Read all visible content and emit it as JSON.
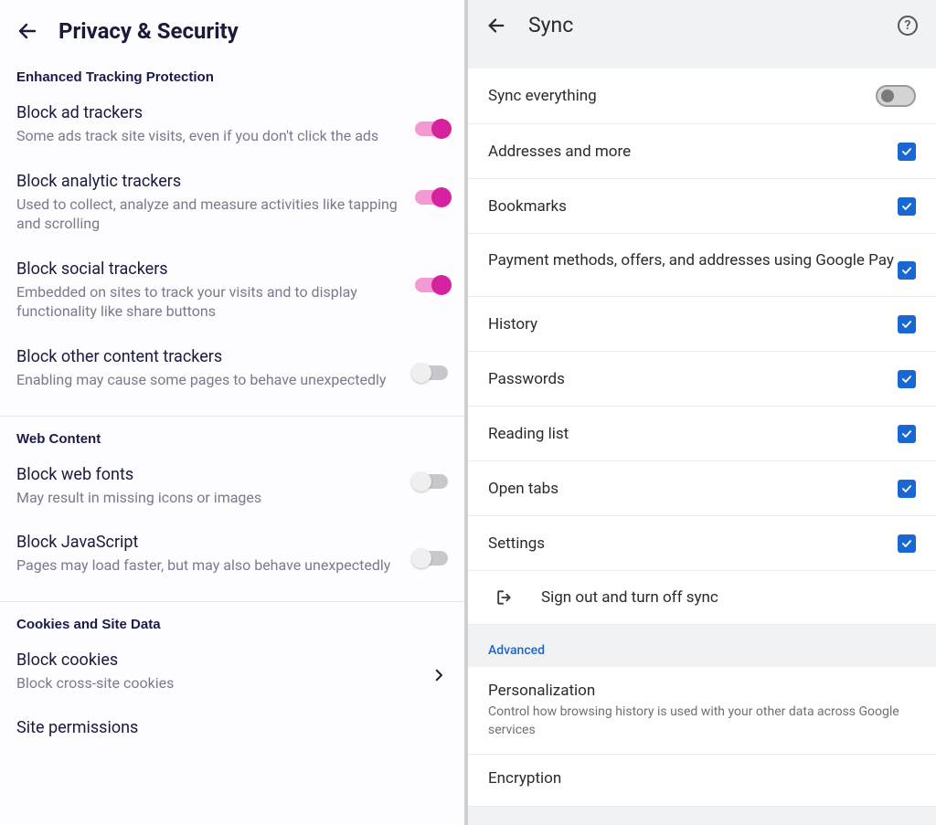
{
  "left": {
    "title": "Privacy & Security",
    "section1": "Enhanced Tracking Protection",
    "items1": [
      {
        "title": "Block ad trackers",
        "sub": "Some ads track site visits, even if you don't click the ads",
        "on": true
      },
      {
        "title": "Block analytic trackers",
        "sub": "Used to collect, analyze and measure activities like tapping and scrolling",
        "on": true
      },
      {
        "title": "Block social trackers",
        "sub": "Embedded on sites to track your visits and to display functionality like share buttons",
        "on": true
      },
      {
        "title": "Block other content trackers",
        "sub": "Enabling may cause some pages to behave unexpectedly",
        "on": false
      }
    ],
    "section2": "Web Content",
    "items2": [
      {
        "title": "Block web fonts",
        "sub": "May result in missing icons or images",
        "on": false
      },
      {
        "title": "Block JavaScript",
        "sub": "Pages may load faster, but may also behave unexpectedly",
        "on": false
      }
    ],
    "section3": "Cookies and Site Data",
    "cookies": {
      "title": "Block cookies",
      "sub": "Block cross-site cookies"
    },
    "sitePerm": "Site permissions"
  },
  "right": {
    "title": "Sync",
    "syncEverything": "Sync everything",
    "items": [
      "Addresses and more",
      "Bookmarks",
      "Payment methods, offers, and addresses using Google Pay",
      "History",
      "Passwords",
      "Reading list",
      "Open tabs",
      "Settings"
    ],
    "signout": "Sign out and turn off sync",
    "advanced": "Advanced",
    "personalization": {
      "title": "Personalization",
      "sub": "Control how browsing history is used with your other data across Google services"
    },
    "encryption": "Encryption"
  }
}
